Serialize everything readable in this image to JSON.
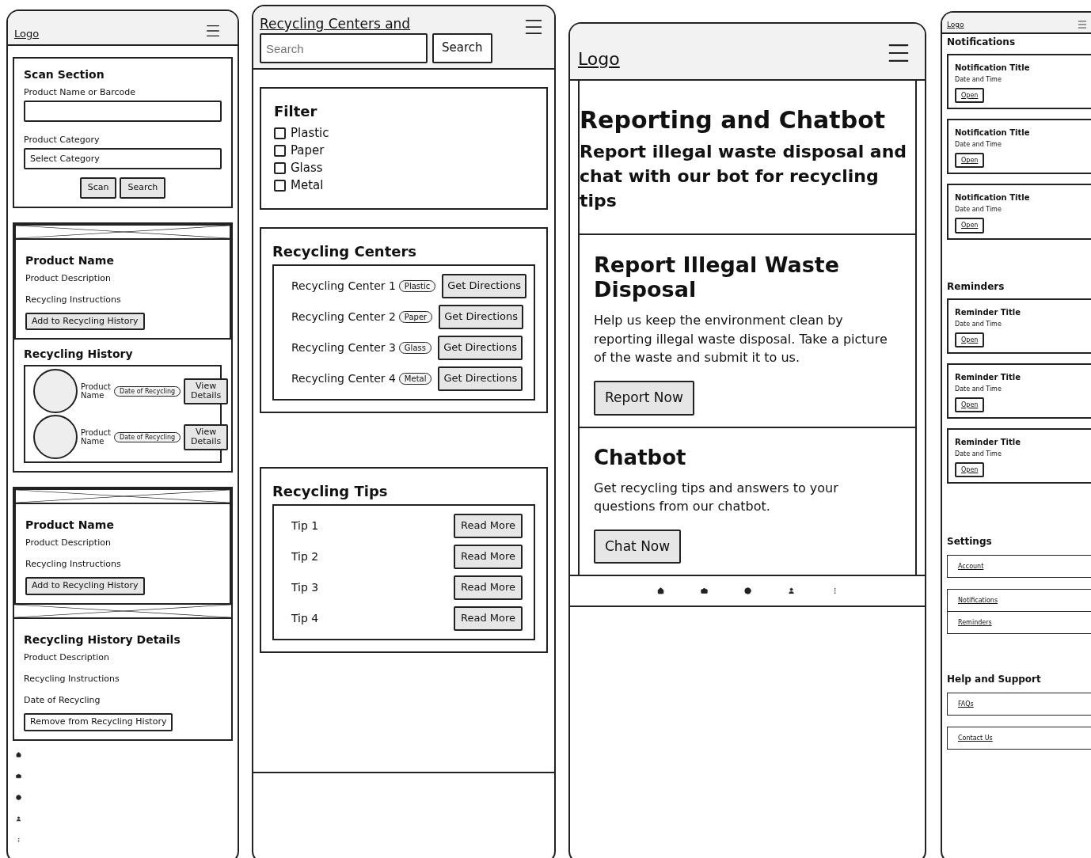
{
  "scan_screen": {
    "logo": "Logo",
    "scan_section": {
      "title": "Scan Section",
      "name_label": "Product Name or Barcode",
      "category_label": "Product Category",
      "category_value": "Select Category",
      "buttons": [
        "Scan",
        "Search"
      ]
    },
    "product_card": {
      "title": "Product Name",
      "description": "Product Description",
      "instructions": "Recycling Instructions",
      "button": "Add to Recycling History"
    },
    "history": {
      "title": "Recycling History",
      "items": [
        {
          "name": "Product Name",
          "date": "Date of Recycling",
          "button": "View Details"
        },
        {
          "name": "Product Name",
          "date": "Date of Recycling",
          "button": "View Details"
        }
      ]
    },
    "product_card_2": {
      "title": "Product Name",
      "description": "Product Description",
      "instructions": "Recycling Instructions",
      "button": "Add to Recycling History"
    },
    "details": {
      "title": "Recycling History Details",
      "description": "Product Description",
      "instructions": "Recycling Instructions",
      "date": "Date of Recycling",
      "button": "Remove from Recycling History"
    }
  },
  "centers_screen": {
    "title": "Recycling Centers and",
    "search_placeholder": "Search",
    "search_button": "Search",
    "filter": {
      "title": "Filter",
      "options": [
        {
          "label": "Plastic",
          "checked": false
        },
        {
          "label": "Paper",
          "checked": false
        },
        {
          "label": "Glass",
          "checked": false
        },
        {
          "label": "Metal",
          "checked": false
        }
      ]
    },
    "centers": {
      "title": "Recycling Centers",
      "items": [
        {
          "name": "Recycling Center 1",
          "tag": "Plastic",
          "button": "Get Directions"
        },
        {
          "name": "Recycling Center 2",
          "tag": "Paper",
          "button": "Get Directions"
        },
        {
          "name": "Recycling Center 3",
          "tag": "Glass",
          "button": "Get Directions"
        },
        {
          "name": "Recycling Center 4",
          "tag": "Metal",
          "button": "Get Directions"
        }
      ]
    },
    "tips": {
      "title": "Recycling Tips",
      "items": [
        {
          "label": "Tip 1",
          "button": "Read More"
        },
        {
          "label": "Tip 2",
          "button": "Read More"
        },
        {
          "label": "Tip 3",
          "button": "Read More"
        },
        {
          "label": "Tip 4",
          "button": "Read More"
        }
      ]
    }
  },
  "reporting_screen": {
    "logo": "Logo",
    "title": "Reporting and Chatbot",
    "subtitle": "Report illegal waste disposal and chat with our bot for recycling tips",
    "cards": [
      {
        "title": "Report Illegal Waste Disposal",
        "text": "Help us keep the environment clean by reporting illegal waste disposal. Take a picture of the waste and submit it to us.",
        "button": "Report Now"
      },
      {
        "title": "Chatbot",
        "text": "Get recycling tips and answers to your questions from our chatbot.",
        "button": "Chat Now"
      }
    ]
  },
  "notifications_screen": {
    "logo": "Logo",
    "notifications": {
      "title": "Notifications",
      "items": [
        {
          "title": "Notification Title",
          "date": "Date and Time",
          "button": "Open"
        },
        {
          "title": "Notification Title",
          "date": "Date and Time",
          "button": "Open"
        },
        {
          "title": "Notification Title",
          "date": "Date and Time",
          "button": "Open"
        }
      ]
    },
    "reminders": {
      "title": "Reminders",
      "items": [
        {
          "title": "Reminder Title",
          "date": "Date and Time",
          "button": "Open"
        },
        {
          "title": "Reminder Title",
          "date": "Date and Time",
          "button": "Open"
        },
        {
          "title": "Reminder Title",
          "date": "Date and Time",
          "button": "Open"
        }
      ]
    },
    "settings": {
      "title": "Settings",
      "groups": [
        [
          "Account"
        ],
        [
          "Notifications",
          "Reminders"
        ]
      ]
    },
    "help": {
      "title": "Help and Support",
      "groups": [
        [
          "FAQs"
        ],
        [
          "Contact Us"
        ]
      ]
    }
  }
}
